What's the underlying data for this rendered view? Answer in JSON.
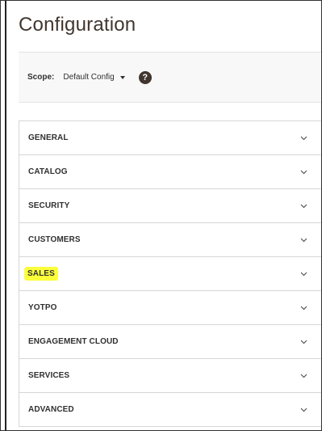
{
  "page": {
    "title": "Configuration"
  },
  "scope": {
    "label": "Scope:",
    "value": "Default Config",
    "help_symbol": "?"
  },
  "sections": [
    {
      "label": "GENERAL",
      "highlighted": false
    },
    {
      "label": "CATALOG",
      "highlighted": false
    },
    {
      "label": "SECURITY",
      "highlighted": false
    },
    {
      "label": "CUSTOMERS",
      "highlighted": false
    },
    {
      "label": "SALES",
      "highlighted": true
    },
    {
      "label": "YOTPO",
      "highlighted": false
    },
    {
      "label": "ENGAGEMENT CLOUD",
      "highlighted": false
    },
    {
      "label": "SERVICES",
      "highlighted": false
    },
    {
      "label": "ADVANCED",
      "highlighted": false
    }
  ],
  "colors": {
    "highlight": "#fbff3a",
    "title": "#41362f",
    "text": "#303030",
    "border": "#d6d6d6",
    "scope_bg": "#f8f8f8"
  },
  "icons": {
    "section_toggle": "chevron-down-icon",
    "help": "help-icon",
    "scope_dropdown": "caret-down-icon"
  }
}
